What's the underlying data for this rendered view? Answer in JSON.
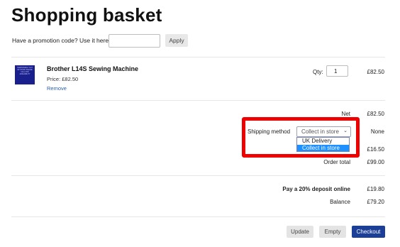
{
  "page": {
    "title": "Shopping basket"
  },
  "promo": {
    "label": "Have a promotion code? Use it here:",
    "value": "",
    "apply_label": "Apply"
  },
  "item": {
    "thumb_text": "TEMPORARILY OUT OF STOCK PLEASE CALL FOR AVAILABILITY",
    "name": "Brother L14S Sewing Machine",
    "price": "Price: £82.50",
    "remove_label": "Remove",
    "qty_label": "Qty:",
    "qty": "1",
    "total": "£82.50"
  },
  "summary": {
    "net_label": "Net",
    "net_value": "£82.50",
    "shipping_label": "Shipping method",
    "shipping_selected": "Collect in store",
    "shipping_value": "None",
    "shipping_options": [
      "UK Delivery",
      "Collect in store"
    ],
    "vat_value": "£16.50",
    "order_total_label": "Order total",
    "order_total_value": "£99.00",
    "deposit_label": "Pay a 20% deposit online",
    "deposit_value": "£19.80",
    "balance_label": "Balance",
    "balance_value": "£79.20"
  },
  "actions": {
    "update_label": "Update",
    "empty_label": "Empty",
    "checkout_label": "Checkout"
  },
  "colors": {
    "highlight": "#ee0000",
    "checkout_bg": "#1b3f97",
    "selected_option": "#1e90ff",
    "link": "#2a5db0"
  },
  "icons": {
    "select_chevron": "chevron-down-icon"
  }
}
